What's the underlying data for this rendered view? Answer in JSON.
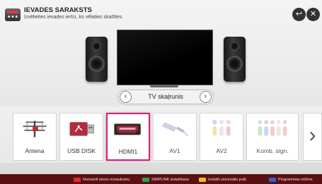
{
  "header": {
    "title": "IEVADES SARAKSTS",
    "subtitle": "Izvēlieties ievades ierīci, ko vēlaties skatīties.",
    "back_icon": "back-arrow-icon",
    "close_icon": "close-icon",
    "back_glyph": "↩",
    "close_glyph": "✕"
  },
  "sound_output": {
    "label": "TV skaļrunis",
    "prev_glyph": "‹",
    "next_glyph": "›"
  },
  "inputs": [
    {
      "label": "Antena",
      "icon": "antenna-icon",
      "state": "normal"
    },
    {
      "label": "USB DISK",
      "icon": "usb-icon",
      "state": "normal"
    },
    {
      "label": "HDMI1",
      "icon": "hdmi-icon",
      "state": "selected"
    },
    {
      "label": "AV1",
      "icon": "av-cable-icon",
      "state": "dimmed"
    },
    {
      "label": "AV2",
      "icon": "av-connector-icon",
      "state": "dimmed"
    },
    {
      "label": "Komb. sign.",
      "icon": "component-connector-icon",
      "state": "dimmed"
    }
  ],
  "next_arrow": "›",
  "footer": {
    "hints": [
      {
        "key_color": "#e02a2a",
        "text": "Nomainīt ielces nosaukumu"
      },
      {
        "key_color": "#2aa54a",
        "text": "SIMPLINK iestatīšana"
      },
      {
        "key_color": "#e8c21a",
        "text": "Iestatīt universālo pulti"
      },
      {
        "key_color": "#2a64d6",
        "text": "Programmas režīms"
      }
    ]
  },
  "colors": {
    "selected_border": "#c8287d",
    "footer_bg": "#5b0f12"
  }
}
